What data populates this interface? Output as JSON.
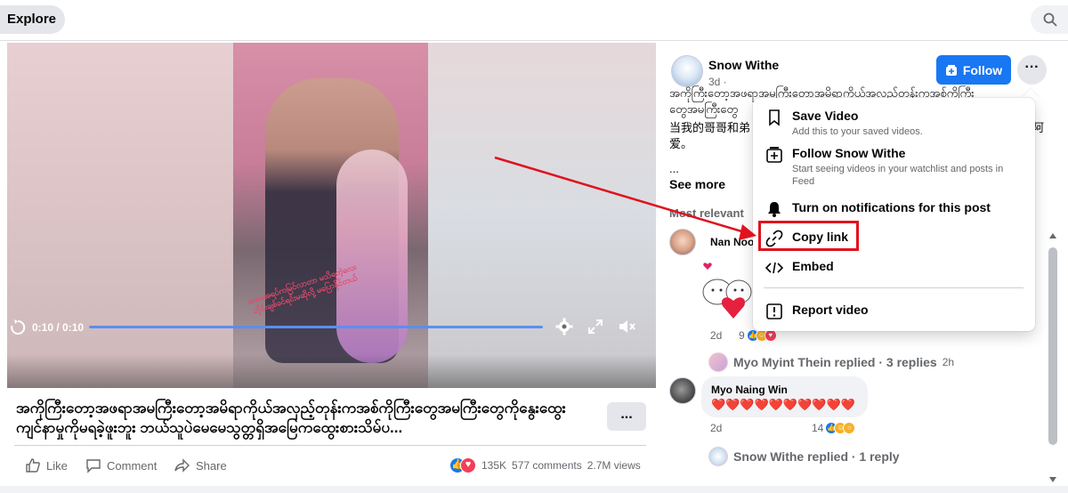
{
  "header": {
    "explore_label": "Explore"
  },
  "video": {
    "time": "0:10 / 0:10",
    "overlay_text": "အမေအရပ်ကမြင်လာတာ မသိရတဲ့လေးတိုင်းချစ်ခင်ရင်းမဆိုလို့ မပြောနိုင်တယ်",
    "progress": 1.0
  },
  "caption": {
    "text": "အကိုကြီးတော့အဖရာအမကြီးတော့အမိရာကိုယ်အလှည့်တုန်းကအစ်ကိုကြီးတွေအမကြီးတွေကိုနွေးထွေးကျင်နာမှုကိုမရခဲ့ဖူးဘူး ဘယ်သူပဲမေမေသွတ္တရှိအမြေကထွေးစားသိမ်ပ...",
    "more_label": "..."
  },
  "actions": {
    "like": "Like",
    "comment": "Comment",
    "share": "Share",
    "reaction_count": "135K",
    "comments_count": "577 comments",
    "views_count": "2.7M views"
  },
  "author": {
    "name": "Snow Withe",
    "meta": "3d ·",
    "follow_label": "Follow",
    "more_label": "···"
  },
  "post": {
    "line1": "အကိုကြီးတော့အဖရာအမကြီးတော့အမိရာကိုယ်အလှည့်တုန်းကအစ်ကိုကြီး",
    "line2": "တွေအမကြီးတွေ",
    "line3": "当我的哥哥和弟",
    "line3_end": "阿",
    "line4": "爱。",
    "ellipsis": "...",
    "see_more": "See more"
  },
  "comments": {
    "sort_label": "Most relevant",
    "c1": {
      "name": "Nan Noo",
      "age": "2d",
      "count": "9"
    },
    "r1": {
      "text": "Myo Myint Thein replied · 3 replies",
      "age": "2h"
    },
    "c2": {
      "name": "Myo Naing Win",
      "body": "❤️❤️❤️❤️❤️❤️❤️❤️❤️❤️",
      "age": "2d",
      "count": "14"
    },
    "r2": {
      "text": "Snow Withe replied · 1 reply"
    }
  },
  "menu": {
    "save_title": "Save Video",
    "save_desc": "Add this to your saved videos.",
    "follow_title": "Follow Snow Withe",
    "follow_desc": "Start seeing videos in your watchlist and posts in Feed",
    "notify_title": "Turn on notifications for this post",
    "copy_title": "Copy link",
    "embed_title": "Embed",
    "report_title": "Report video"
  },
  "colors": {
    "accent": "#1877f2",
    "highlight": "#e0121e"
  }
}
